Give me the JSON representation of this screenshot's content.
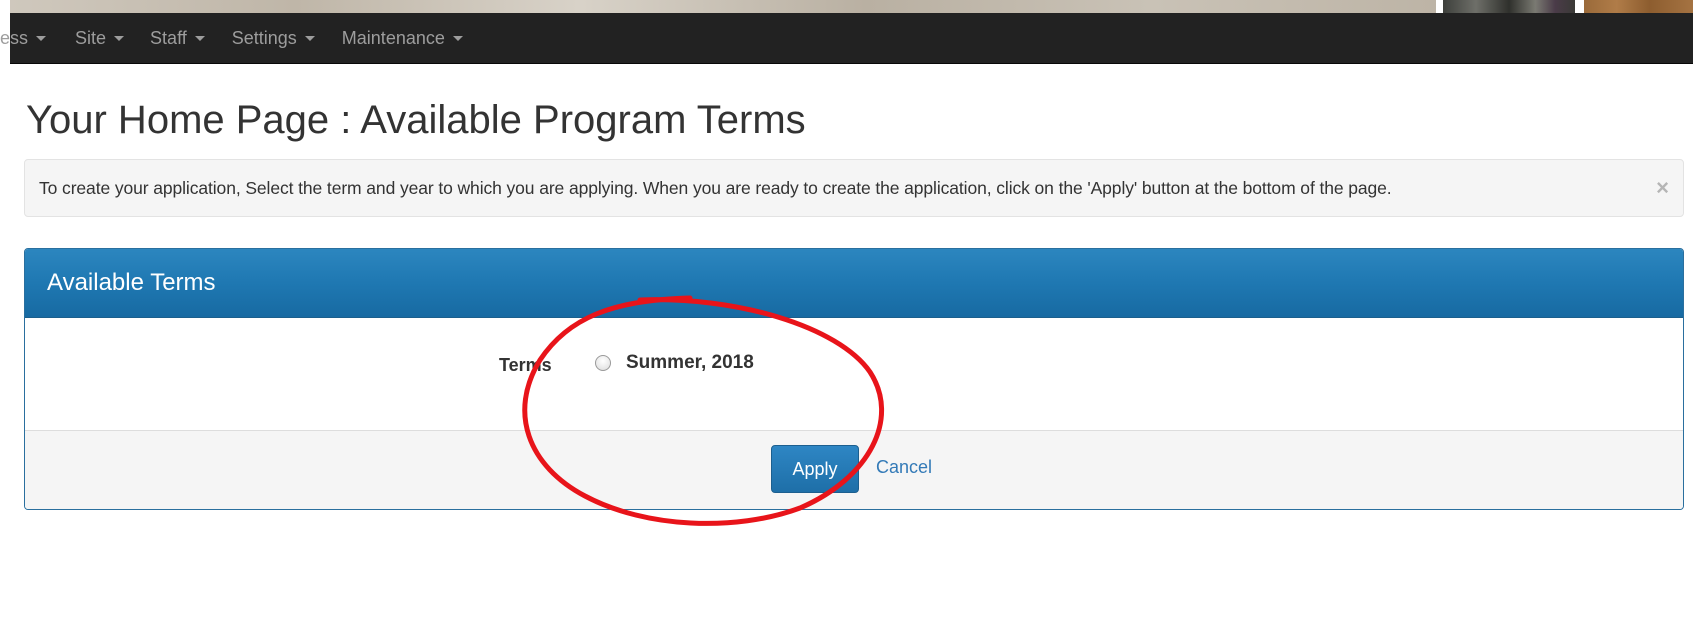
{
  "navbar": {
    "items": [
      {
        "label": "ess"
      },
      {
        "label": "Site"
      },
      {
        "label": "Staff"
      },
      {
        "label": "Settings"
      },
      {
        "label": "Maintenance"
      }
    ]
  },
  "page": {
    "title": "Your Home Page : Available Program Terms"
  },
  "alert": {
    "text": "To create your application, Select the term and year to which you are applying. When you are ready to create the application, click on the 'Apply' button at the bottom of the page.",
    "close_symbol": "×"
  },
  "panel": {
    "title": "Available Terms",
    "field_label": "Terms",
    "options": [
      {
        "label": "Summer, 2018",
        "selected": false
      }
    ],
    "apply_label": "Apply",
    "cancel_label": "Cancel"
  },
  "annotation": {
    "shape": "ellipse",
    "color": "#e8141a"
  },
  "colors": {
    "navbar_bg": "#222222",
    "panel_header": "#1f78b2",
    "primary_button": "#2479b4",
    "link": "#337ab7"
  }
}
